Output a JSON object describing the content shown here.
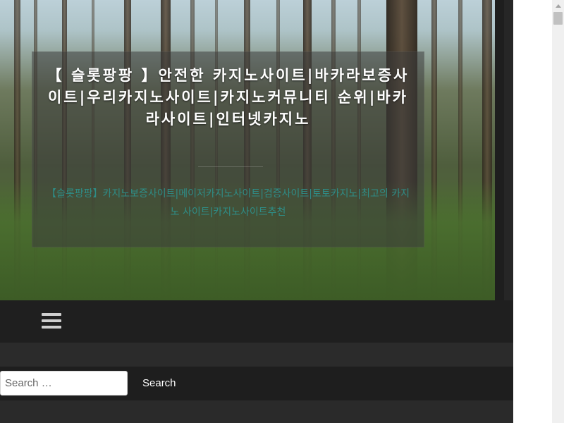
{
  "header": {
    "site_title": "【 슬롯팡팡 】안전한 카지노사이트|바카라보증사이트|우리카지노사이트|카지노커뮤니티 순위|바카라사이트|인터넷카지노",
    "site_description": "【슬롯팡팡】카지노보증사이트|메이저카지노사이트|검증사이트|토토카지노|최고의 카지노 사이트|카지노사이트추천"
  },
  "nav": {
    "menu_icon": "hamburger-menu-icon"
  },
  "search": {
    "placeholder": "Search …",
    "button_label": "Search"
  },
  "colors": {
    "description_accent": "#2e8d87",
    "navbar_bg": "#1f1f1f",
    "page_bg": "#262626"
  }
}
